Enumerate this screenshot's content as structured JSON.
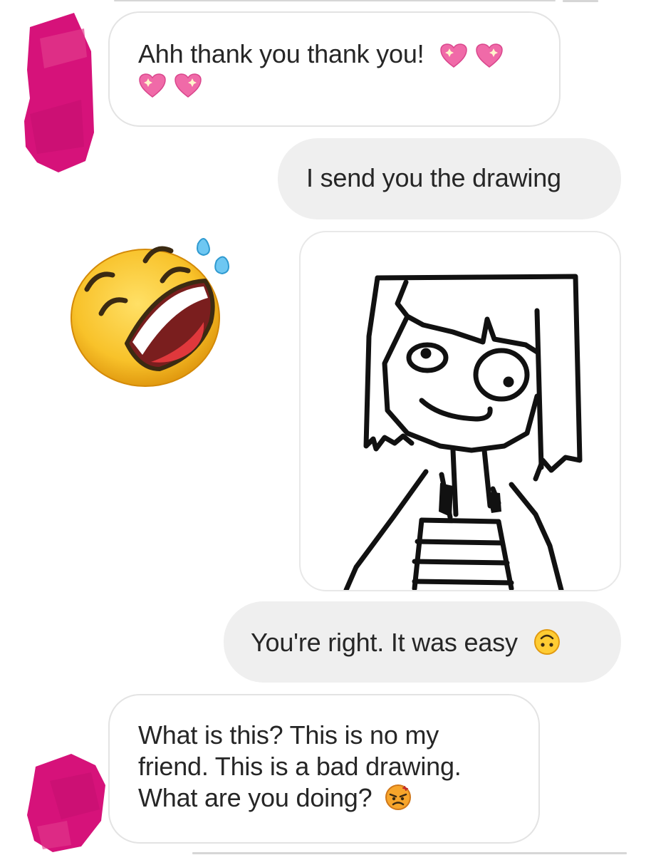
{
  "conversation": {
    "messages": [
      {
        "direction": "received",
        "text": "Ahh thank you thank you!",
        "emojis": [
          "sparkling-heart",
          "sparkling-heart",
          "sparkling-heart",
          "sparkling-heart"
        ]
      },
      {
        "direction": "sent",
        "text": "I send you the drawing"
      },
      {
        "direction": "sent",
        "type": "image",
        "description_icon": "stick-figure-drawing"
      },
      {
        "direction": "sent",
        "text": "You're right. It was easy",
        "emojis": [
          "upside-down-face"
        ]
      },
      {
        "direction": "received",
        "text_lines": [
          "What is this? This is no my",
          "friend. This is a bad drawing.",
          "What are you doing?"
        ],
        "emojis": [
          "angry-face"
        ]
      }
    ],
    "reaction_emoji": "rolling-on-floor-laughing"
  },
  "colors": {
    "received_bubble_bg": "#ffffff",
    "received_bubble_border": "#e3e3e3",
    "sent_bubble_bg": "#efefef",
    "text": "#262626",
    "redaction_pink": "#d6127a"
  }
}
